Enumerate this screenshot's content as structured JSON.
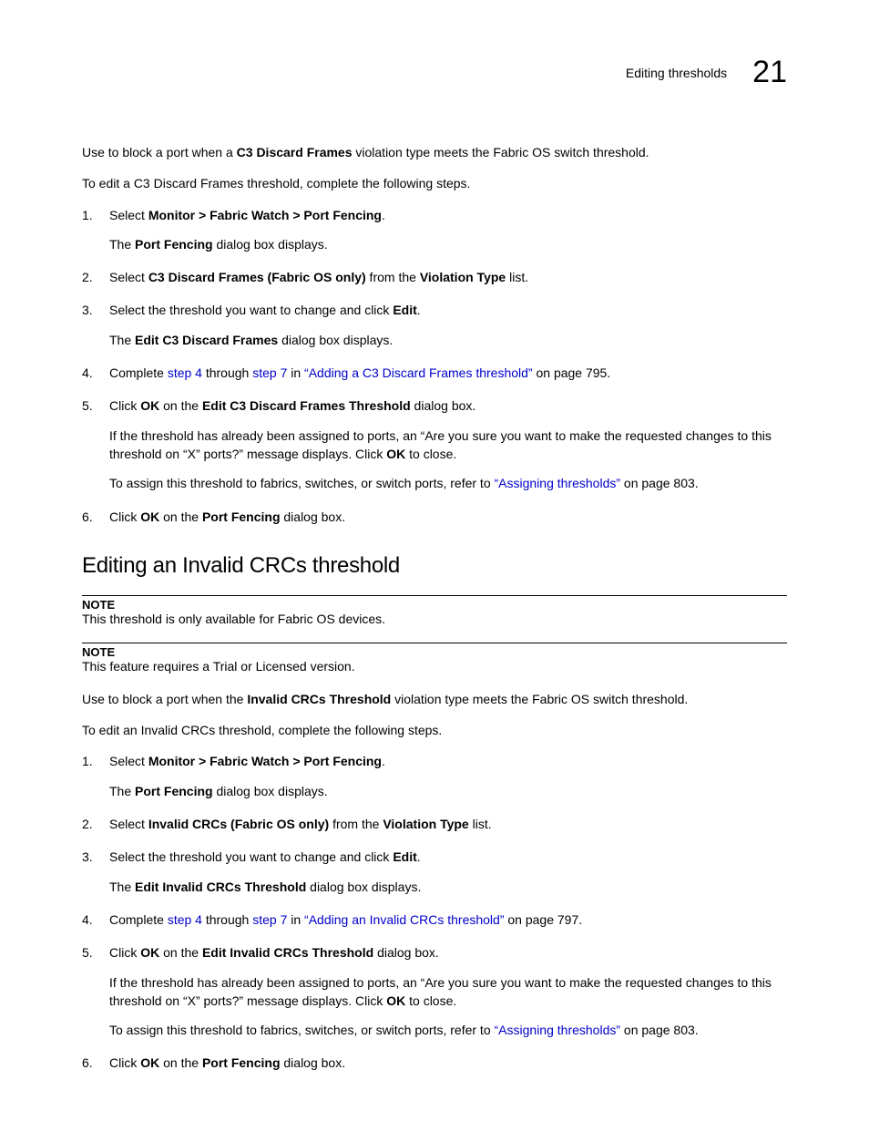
{
  "header": {
    "title": "Editing thresholds",
    "chapter": "21"
  },
  "intro1_a": "Use to block a port when a ",
  "intro1_b": "C3 Discard Frames",
  "intro1_c": " violation type meets the Fabric OS switch threshold.",
  "intro2": "To edit a C3 Discard Frames threshold, complete the following steps.",
  "sec1": {
    "s1a": "Select ",
    "s1b": "Monitor > Fabric Watch > Port Fencing",
    "s1c": ".",
    "s1_sub_a": "The ",
    "s1_sub_b": "Port Fencing",
    "s1_sub_c": " dialog box displays.",
    "s2a": "Select ",
    "s2b": "C3 Discard Frames (Fabric OS only)",
    "s2c": " from the ",
    "s2d": "Violation Type",
    "s2e": " list.",
    "s3a": "Select the threshold you want to change and click ",
    "s3b": "Edit",
    "s3c": ".",
    "s3_sub_a": "The ",
    "s3_sub_b": "Edit C3 Discard Frames",
    "s3_sub_c": " dialog box displays.",
    "s4a": "Complete ",
    "s4b": "step 4",
    "s4c": " through ",
    "s4d": "step 7",
    "s4e": " in ",
    "s4f": "“Adding a C3 Discard Frames threshold”",
    "s4g": " on page 795.",
    "s5a": "Click ",
    "s5b": "OK",
    "s5c": " on the ",
    "s5d": "Edit C3 Discard Frames Threshold",
    "s5e": " dialog box.",
    "s5_sub1a": "If the threshold has already been assigned to ports, an “Are you sure you want to make the requested changes to this threshold on “X” ports?” message displays. Click ",
    "s5_sub1b": "OK",
    "s5_sub1c": " to close.",
    "s5_sub2a": "To assign this threshold to fabrics, switches, or switch ports, refer to ",
    "s5_sub2b": "“Assigning thresholds”",
    "s5_sub2c": " on page 803.",
    "s6a": "Click ",
    "s6b": "OK",
    "s6c": " on the ",
    "s6d": "Port Fencing",
    "s6e": " dialog box."
  },
  "h2": "Editing an Invalid CRCs threshold",
  "note_label": "NOTE",
  "note1": "This threshold is only available for Fabric OS devices.",
  "note2": "This feature requires a Trial or Licensed version.",
  "intro3_a": "Use to block a port when the ",
  "intro3_b": "Invalid CRCs Threshold",
  "intro3_c": " violation type meets the Fabric OS switch threshold.",
  "intro4": "To edit an Invalid CRCs threshold, complete the following steps.",
  "sec2": {
    "s1a": "Select ",
    "s1b": "Monitor > Fabric Watch > Port Fencing",
    "s1c": ".",
    "s1_sub_a": "The ",
    "s1_sub_b": "Port Fencing",
    "s1_sub_c": " dialog box displays.",
    "s2a": "Select ",
    "s2b": "Invalid CRCs (Fabric OS only)",
    "s2c": " from the ",
    "s2d": "Violation Type",
    "s2e": " list.",
    "s3a": "Select the threshold you want to change and click ",
    "s3b": "Edit",
    "s3c": ".",
    "s3_sub_a": "The ",
    "s3_sub_b": "Edit Invalid CRCs Threshold",
    "s3_sub_c": " dialog box displays.",
    "s4a": "Complete ",
    "s4b": "step 4",
    "s4c": " through ",
    "s4d": "step 7",
    "s4e": " in ",
    "s4f": "“Adding an Invalid CRCs threshold”",
    "s4g": " on page 797.",
    "s5a": "Click ",
    "s5b": "OK",
    "s5c": " on the ",
    "s5d": "Edit Invalid CRCs Threshold",
    "s5e": " dialog box.",
    "s5_sub1a": "If the threshold has already been assigned to ports, an “Are you sure you want to make the requested changes to this threshold on “X” ports?” message displays. Click ",
    "s5_sub1b": "OK",
    "s5_sub1c": " to close.",
    "s5_sub2a": "To assign this threshold to fabrics, switches, or switch ports, refer to ",
    "s5_sub2b": "“Assigning thresholds”",
    "s5_sub2c": " on page 803.",
    "s6a": "Click ",
    "s6b": "OK",
    "s6c": " on the ",
    "s6d": "Port Fencing",
    "s6e": " dialog box."
  }
}
